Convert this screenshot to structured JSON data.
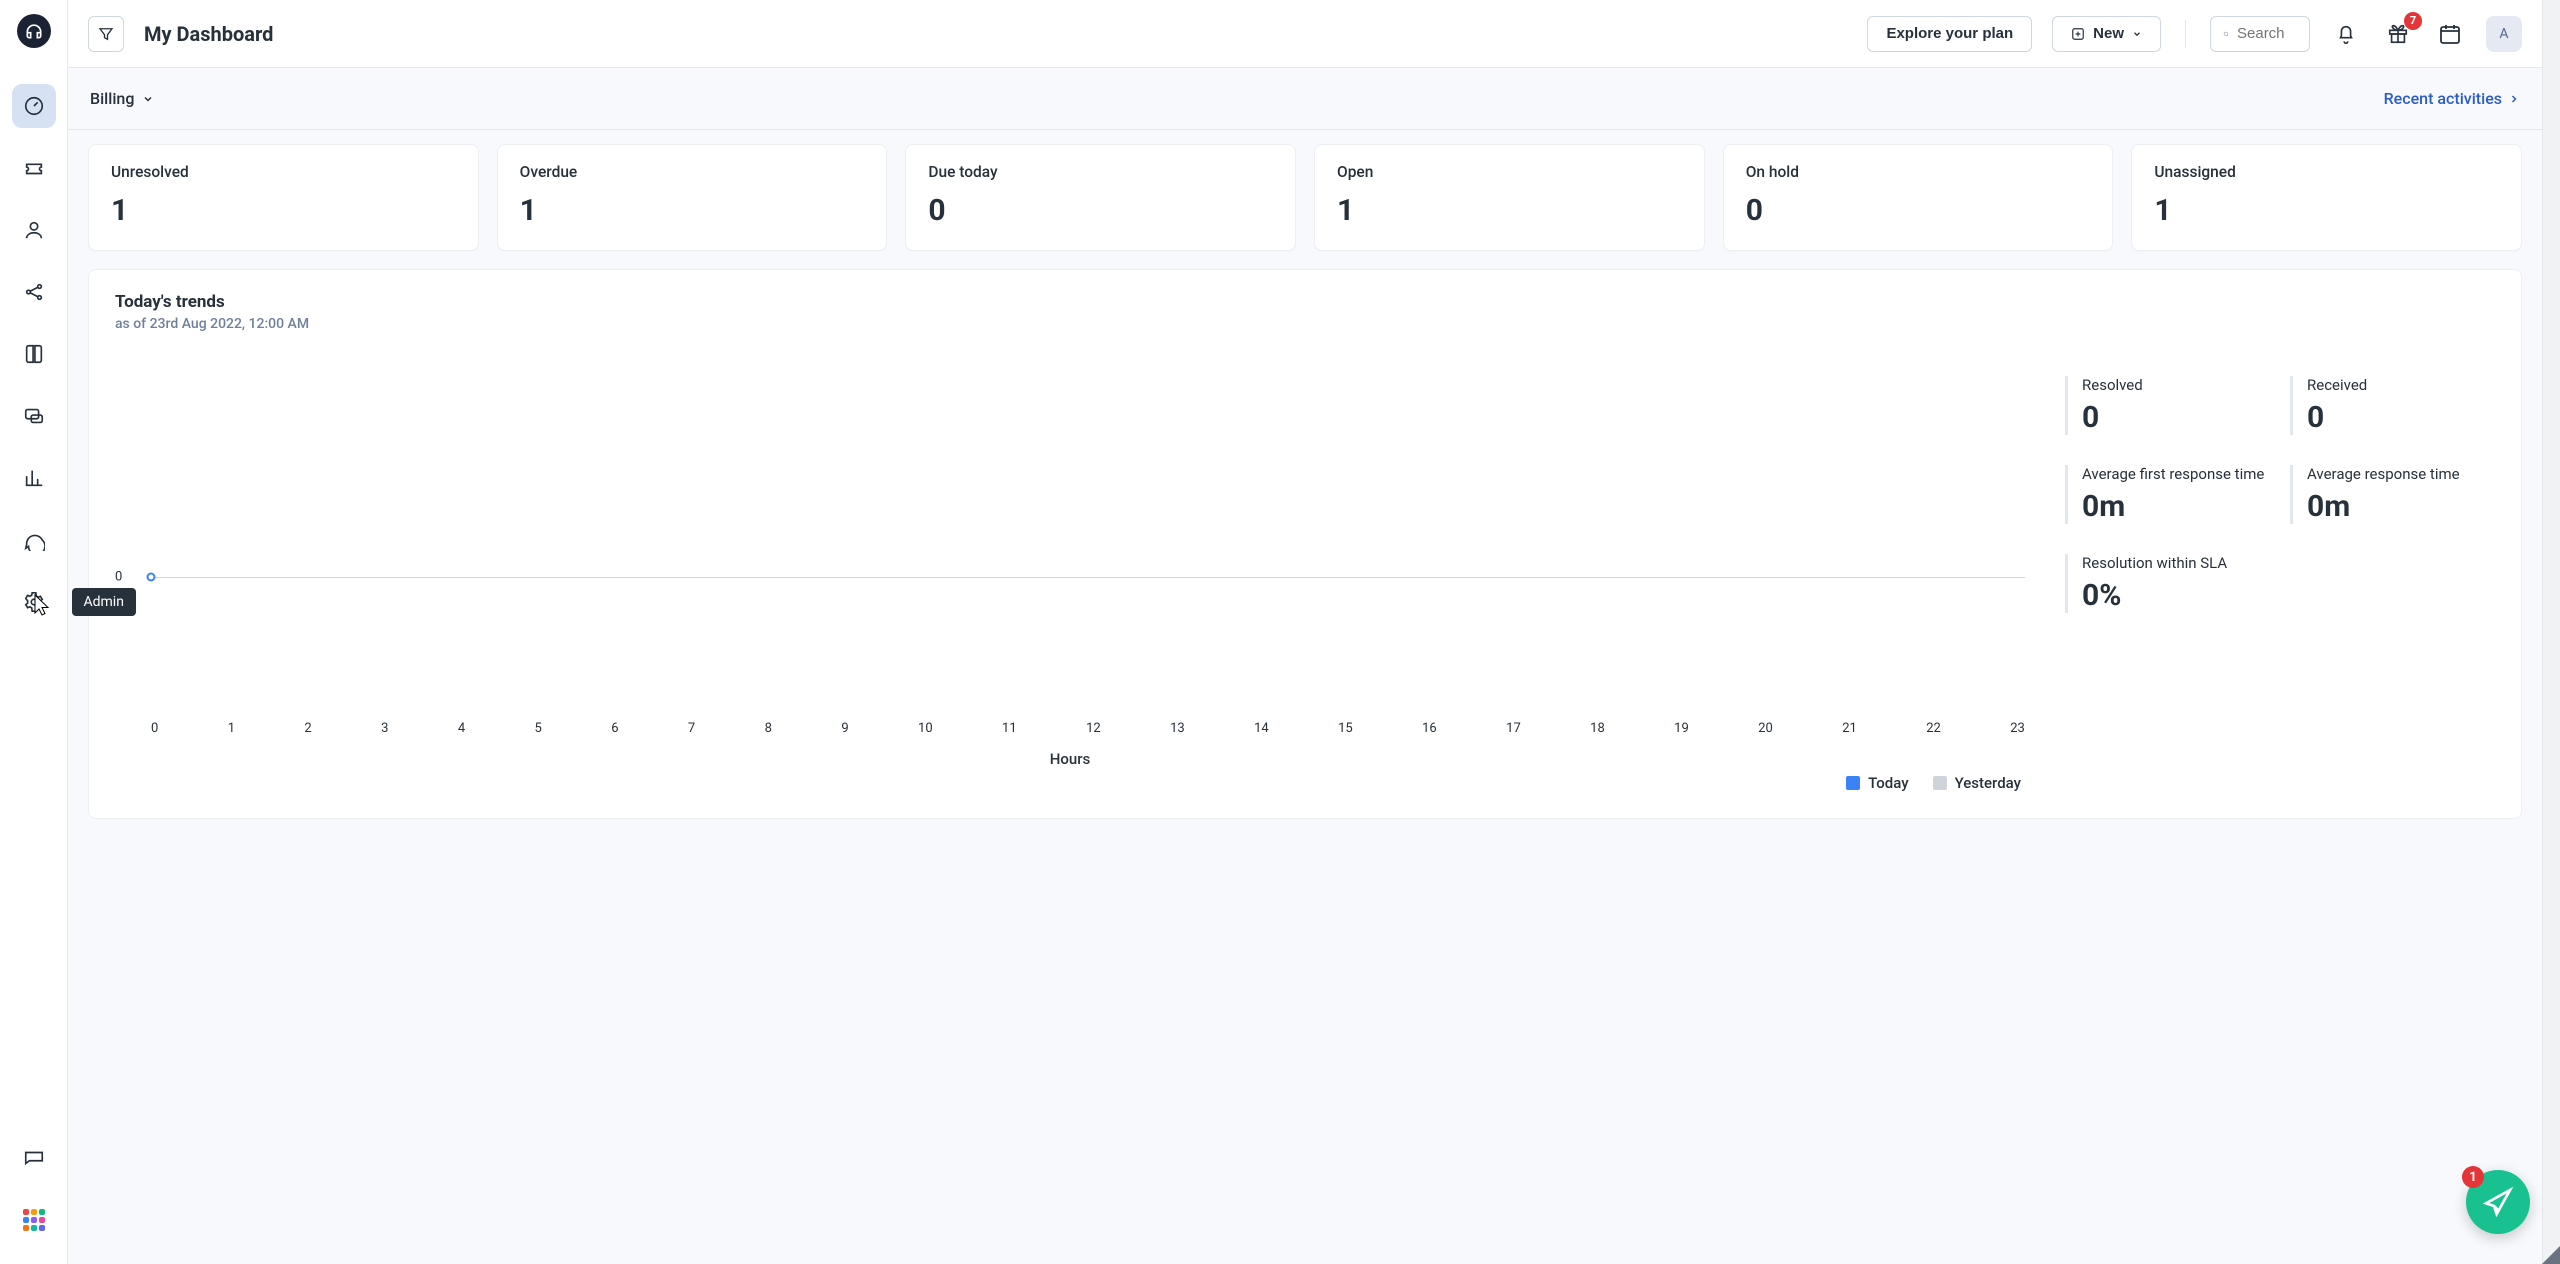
{
  "sidebar": {
    "tooltip": "Admin"
  },
  "topbar": {
    "title": "My Dashboard",
    "explore": "Explore your plan",
    "new": "New",
    "search_placeholder": "Search",
    "gift_badge": "7",
    "avatar": "A"
  },
  "subbar": {
    "group": "Billing",
    "recent": "Recent activities"
  },
  "kpis": [
    {
      "label": "Unresolved",
      "value": "1"
    },
    {
      "label": "Overdue",
      "value": "1"
    },
    {
      "label": "Due today",
      "value": "0"
    },
    {
      "label": "Open",
      "value": "1"
    },
    {
      "label": "On hold",
      "value": "0"
    },
    {
      "label": "Unassigned",
      "value": "1"
    }
  ],
  "trends": {
    "title": "Today's trends",
    "subtitle": "as of 23rd Aug 2022, 12:00 AM",
    "xlabel": "Hours",
    "legend": {
      "today": "Today",
      "yesterday": "Yesterday"
    },
    "colors": {
      "today": "#3b82f6",
      "yesterday": "#cfd3da"
    },
    "ytick": "0",
    "xticks": [
      "0",
      "1",
      "2",
      "3",
      "4",
      "5",
      "6",
      "7",
      "8",
      "9",
      "10",
      "11",
      "12",
      "13",
      "14",
      "15",
      "16",
      "17",
      "18",
      "19",
      "20",
      "21",
      "22",
      "23"
    ]
  },
  "metrics": [
    {
      "label": "Resolved",
      "value": "0"
    },
    {
      "label": "Received",
      "value": "0"
    },
    {
      "label": "Average first response time",
      "value": "0m"
    },
    {
      "label": "Average response time",
      "value": "0m"
    },
    {
      "label": "Resolution within SLA",
      "value": "0%"
    }
  ],
  "fab": {
    "badge": "1"
  },
  "chart_data": {
    "type": "line",
    "title": "Today's trends",
    "xlabel": "Hours",
    "ylabel": "",
    "x": [
      0,
      1,
      2,
      3,
      4,
      5,
      6,
      7,
      8,
      9,
      10,
      11,
      12,
      13,
      14,
      15,
      16,
      17,
      18,
      19,
      20,
      21,
      22,
      23
    ],
    "series": [
      {
        "name": "Today",
        "color": "#3b82f6",
        "values": [
          0,
          null,
          null,
          null,
          null,
          null,
          null,
          null,
          null,
          null,
          null,
          null,
          null,
          null,
          null,
          null,
          null,
          null,
          null,
          null,
          null,
          null,
          null,
          null
        ]
      },
      {
        "name": "Yesterday",
        "color": "#cfd3da",
        "values": [
          null,
          null,
          null,
          null,
          null,
          null,
          null,
          null,
          null,
          null,
          null,
          null,
          null,
          null,
          null,
          null,
          null,
          null,
          null,
          null,
          null,
          null,
          null,
          null
        ]
      }
    ],
    "ylim": [
      0,
      0
    ]
  }
}
